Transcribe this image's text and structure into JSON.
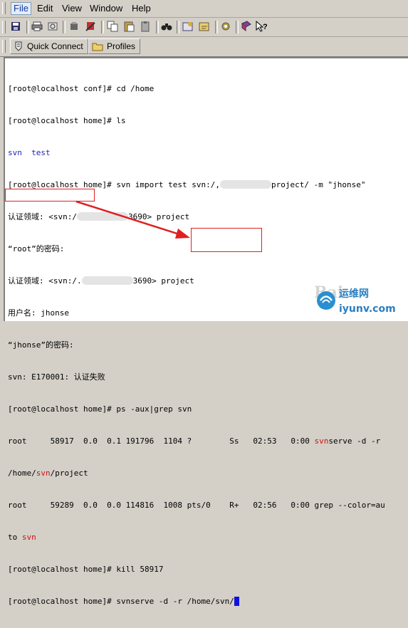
{
  "menubar": {
    "items": [
      {
        "label": "File"
      },
      {
        "label": "Edit"
      },
      {
        "label": "View"
      },
      {
        "label": "Window"
      },
      {
        "label": "Help"
      }
    ]
  },
  "toolbar": {
    "buttons": [
      "save-icon",
      "print-icon",
      "find-icon",
      "disconnect-icon",
      "copy-icon",
      "paste-icon",
      "clipboard-icon",
      "binoculars-icon",
      "settings-icon",
      "profile-icon",
      "gear-icon",
      "book-icon",
      "help-cursor-icon"
    ]
  },
  "toolbar2": {
    "quick_connect": "Quick Connect",
    "profiles": "Profiles"
  },
  "terminal": {
    "lines": [
      "[root@localhost conf]# cd /home",
      "[root@localhost home]# ls",
      "svn  test",
      "[root@localhost home]# svn import test svn:/,",
      "project/ -m \"jhonse\"",
      "认证领域: <svn:/",
      "3690> project",
      "“root”的密码:",
      "认证领域: <svn:/.",
      "3690> project",
      "用户名: jhonse",
      "“jhonse”的密码:",
      "svn: E170001: 认证失败",
      "[root@localhost home]# ps -aux|grep svn",
      "root     58917  0.0  0.1 191796  1104 ?        Ss   02:53   0:00 ",
      "svn",
      "serve -d -r",
      "/home/",
      "svn",
      "/project",
      "root     59289  0.0  0.0 114816  1008 pts/0    R+   02:56   0:00 grep --color=au",
      "to ",
      "svn",
      "[root@localhost home]# kill 58917",
      "[root@localhost home]# svnserve -d -r ",
      "/home/svn/"
    ],
    "colors": {
      "highlight": "#d01010",
      "dir": "#2020c0",
      "annotation": "#e02020"
    }
  },
  "watermark": {
    "brand_cn": "运维网",
    "brand_url": "iyunv.com",
    "baidu": "Bai"
  }
}
